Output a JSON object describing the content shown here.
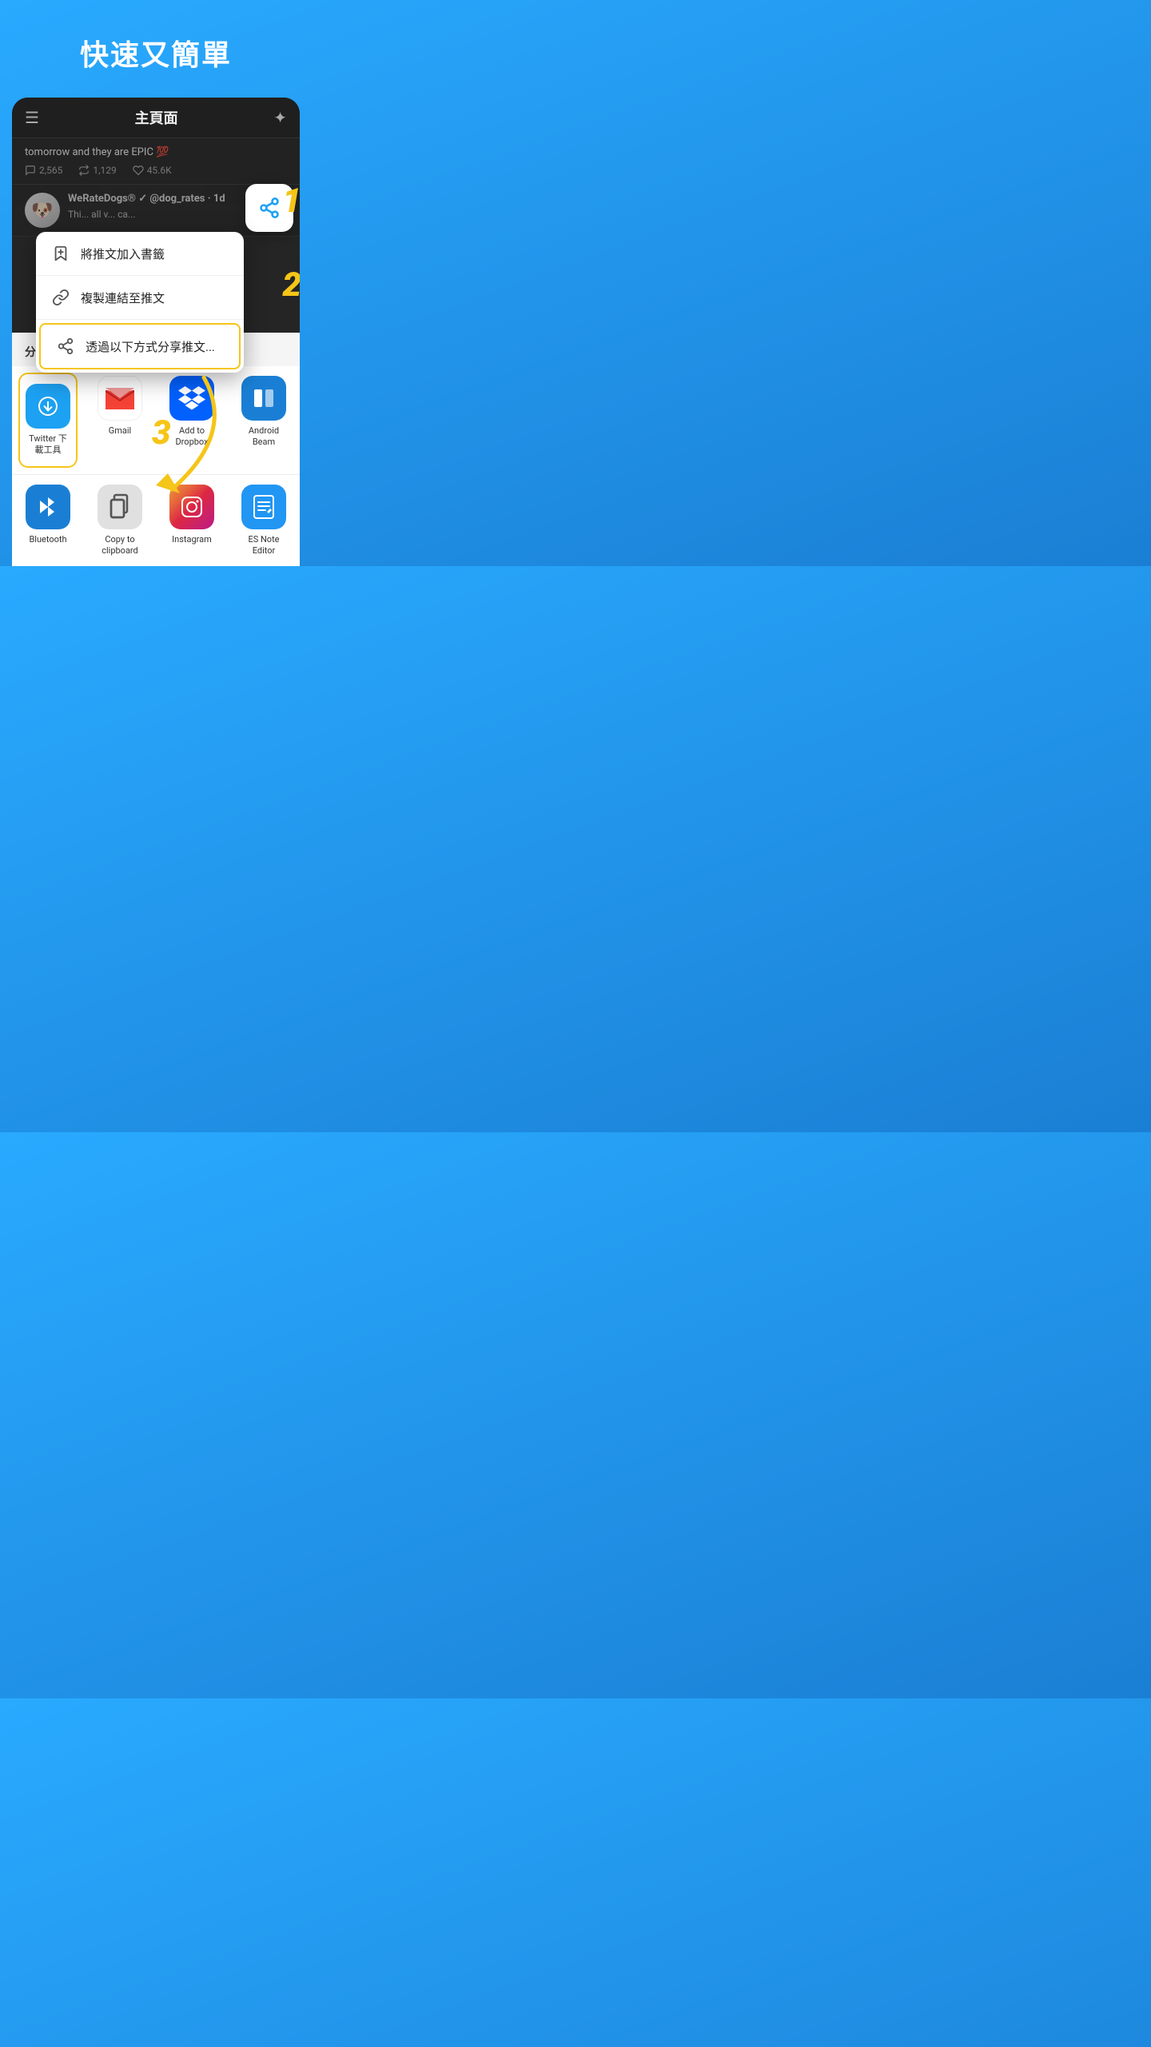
{
  "hero": {
    "title": "快速又簡單"
  },
  "header": {
    "title": "主頁面"
  },
  "tweet1": {
    "text": "tomorrow  and they are EPIC 💯",
    "comments": "2,565",
    "retweets": "1,129",
    "likes": "45.6K"
  },
  "tweet2": {
    "author": "WeRateDogs® ✓ @dog_rates · 1d",
    "body": "Thi... all v... ca..."
  },
  "menu": {
    "item1": "將推文加入書籤",
    "item2": "複製連結至推文",
    "item3": "透過以下方式分享推文..."
  },
  "share": {
    "label": "分享"
  },
  "apps": {
    "row1": [
      {
        "id": "twitter-dl",
        "label": "Twitter 下\n載工具",
        "color": "#1da1f2"
      },
      {
        "id": "gmail",
        "label": "Gmail",
        "color": "#d93025"
      },
      {
        "id": "dropbox",
        "label": "Add to\nDropbox",
        "color": "#0061fe"
      },
      {
        "id": "beam",
        "label": "Android\nBeam",
        "color": "#1a7fd4"
      }
    ],
    "row2": [
      {
        "id": "bluetooth",
        "label": "Bluetooth",
        "color": "#1a7fd4"
      },
      {
        "id": "copy",
        "label": "Copy to\nclipboard",
        "color": "#e0e0e0"
      },
      {
        "id": "instagram",
        "label": "Instagram",
        "color": "#e1306c"
      },
      {
        "id": "es",
        "label": "ES Note\nEditor",
        "color": "#2196f3"
      }
    ]
  },
  "steps": {
    "s1": "1",
    "s2": "2",
    "s3": "3"
  }
}
